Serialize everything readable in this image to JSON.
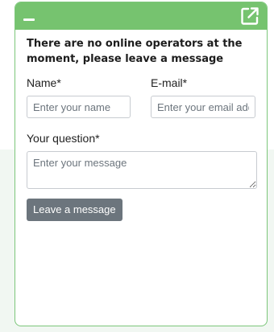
{
  "widget": {
    "header": {
      "minimize_icon": "minimize-icon",
      "popout_icon": "external-link-icon",
      "color": "#76c36f"
    },
    "notice": "There are no online operators at the moment, please leave a message",
    "form": {
      "name_label": "Name*",
      "name_placeholder": "Enter your name",
      "email_label": "E-mail*",
      "email_placeholder": "Enter your email address",
      "question_label": "Your question*",
      "question_placeholder": "Enter your message",
      "submit_label": "Leave a message"
    }
  }
}
